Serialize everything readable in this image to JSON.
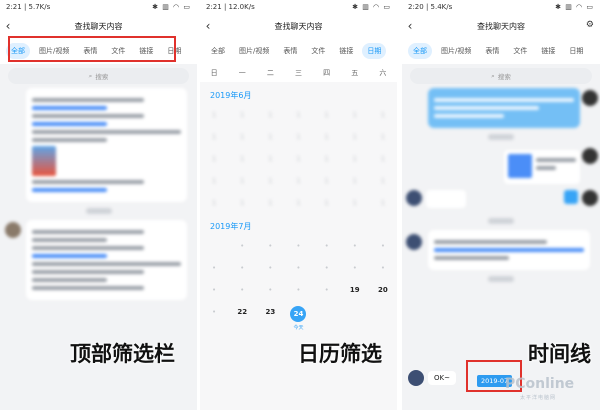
{
  "screens": [
    {
      "status": {
        "time": "2:21",
        "speed": "5.7K/s",
        "icons": "✱ ▥ ◠ ▭"
      },
      "title": "查找聊天内容",
      "tabs": [
        "全部",
        "图片/视频",
        "表情",
        "文件",
        "链接",
        "日期"
      ],
      "active_tab": 0,
      "search_placeholder": "搜索",
      "caption": "顶部筛选栏"
    },
    {
      "status": {
        "time": "2:21",
        "speed": "12.0K/s",
        "icons": "✱ ▥ ◠ ▭"
      },
      "title": "查找聊天内容",
      "tabs": [
        "全部",
        "图片/视频",
        "表情",
        "文件",
        "链接",
        "日期"
      ],
      "active_tab": 5,
      "weekdays": [
        "日",
        "一",
        "二",
        "三",
        "四",
        "五",
        "六"
      ],
      "months": [
        {
          "label": "2019年6月"
        },
        {
          "label": "2019年7月"
        }
      ],
      "july_active_days": [
        "19",
        "20",
        "22",
        "23",
        "24"
      ],
      "today": {
        "day": "24",
        "label": "今天"
      },
      "caption": "日历筛选"
    },
    {
      "status": {
        "time": "2:20",
        "speed": "5.4K/s",
        "icons": "✱ ▥ ◠ ▭"
      },
      "title": "查找聊天内容",
      "tabs": [
        "全部",
        "图片/视频",
        "表情",
        "文件",
        "链接",
        "日期"
      ],
      "active_tab": 0,
      "search_placeholder": "搜索",
      "caption": "时间线",
      "last_message": "OK~",
      "timeline_date": "2019-07",
      "watermark": "PConline",
      "watermark_sub": "太平洋电脑网"
    }
  ],
  "colors": {
    "accent": "#1b9af7",
    "highlight_box": "#e0312c"
  }
}
